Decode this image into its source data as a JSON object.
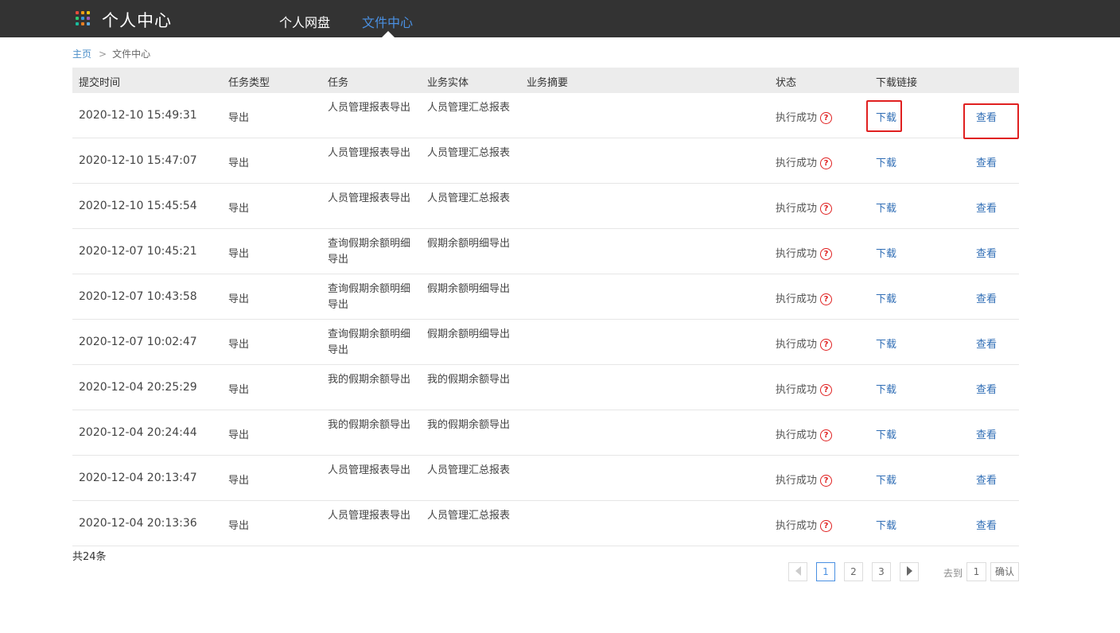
{
  "header": {
    "app_title": "个人中心",
    "logo_icon": "app-grid-icon",
    "logo_colors": [
      "#e74c3c",
      "#f39c12",
      "#f1c40f",
      "#2ecc71",
      "#3498db",
      "#9b59b6",
      "#1abc9c",
      "#e67e22",
      "#5dade2"
    ],
    "nav": [
      {
        "label": "个人网盘",
        "active": false
      },
      {
        "label": "文件中心",
        "active": true
      }
    ],
    "active_color": "#4a90e2"
  },
  "breadcrumb": {
    "home": "主页",
    "separator": ">",
    "current": "文件中心"
  },
  "table": {
    "columns": [
      "提交时间",
      "任务类型",
      "任务",
      "业务实体",
      "业务摘要",
      "状态",
      "下载链接"
    ],
    "rows": [
      {
        "time": "2020-12-10 15:49:31",
        "type": "导出",
        "task": "人员管理报表导出",
        "entity": "人员管理汇总报表",
        "summary": "",
        "status": "执行成功",
        "download": "下载",
        "view": "查看"
      },
      {
        "time": "2020-12-10 15:47:07",
        "type": "导出",
        "task": "人员管理报表导出",
        "entity": "人员管理汇总报表",
        "summary": "",
        "status": "执行成功",
        "download": "下载",
        "view": "查看"
      },
      {
        "time": "2020-12-10 15:45:54",
        "type": "导出",
        "task": "人员管理报表导出",
        "entity": "人员管理汇总报表",
        "summary": "",
        "status": "执行成功",
        "download": "下载",
        "view": "查看"
      },
      {
        "time": "2020-12-07 10:45:21",
        "type": "导出",
        "task": "查询假期余额明细导出",
        "entity": "假期余额明细导出",
        "summary": "",
        "status": "执行成功",
        "download": "下载",
        "view": "查看"
      },
      {
        "time": "2020-12-07 10:43:58",
        "type": "导出",
        "task": "查询假期余额明细导出",
        "entity": "假期余额明细导出",
        "summary": "",
        "status": "执行成功",
        "download": "下载",
        "view": "查看"
      },
      {
        "time": "2020-12-07 10:02:47",
        "type": "导出",
        "task": "查询假期余额明细导出",
        "entity": "假期余额明细导出",
        "summary": "",
        "status": "执行成功",
        "download": "下载",
        "view": "查看"
      },
      {
        "time": "2020-12-04 20:25:29",
        "type": "导出",
        "task": "我的假期余额导出",
        "entity": "我的假期余额导出",
        "summary": "",
        "status": "执行成功",
        "download": "下载",
        "view": "查看"
      },
      {
        "time": "2020-12-04 20:24:44",
        "type": "导出",
        "task": "我的假期余额导出",
        "entity": "我的假期余额导出",
        "summary": "",
        "status": "执行成功",
        "download": "下载",
        "view": "查看"
      },
      {
        "time": "2020-12-04 20:13:47",
        "type": "导出",
        "task": "人员管理报表导出",
        "entity": "人员管理汇总报表",
        "summary": "",
        "status": "执行成功",
        "download": "下载",
        "view": "查看"
      },
      {
        "time": "2020-12-04 20:13:36",
        "type": "导出",
        "task": "人员管理报表导出",
        "entity": "人员管理汇总报表",
        "summary": "",
        "status": "执行成功",
        "download": "下载",
        "view": "查看"
      }
    ],
    "status_icon": "question-circle-icon",
    "link_color": "#2f6db5",
    "highlight_color": "#e02020"
  },
  "footer": {
    "total": "共24条",
    "pagination": {
      "pages": [
        "1",
        "2",
        "3"
      ],
      "current": "1",
      "prev_icon": "prev-arrow-icon",
      "next_icon": "next-arrow-icon"
    },
    "goto_label": "去到",
    "goto_value": "1",
    "confirm": "确认"
  }
}
